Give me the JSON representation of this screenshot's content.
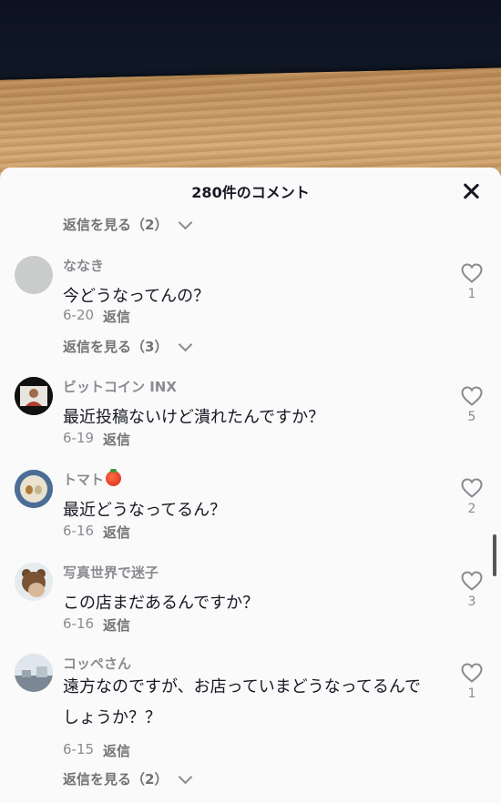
{
  "header": {
    "title": "280件のコメント"
  },
  "colors": {
    "sheet_bg": "#fafafa",
    "text": "#161823",
    "muted": "#8a8b91"
  },
  "view_replies_top": "返信を見る（2）",
  "comments": [
    {
      "username": "ななき",
      "text": "今どうなってんの？",
      "date": "6-20",
      "reply": "返信",
      "likes": "1",
      "view_replies": "返信を見る（3）",
      "avatar_icon": "gray-avatar"
    },
    {
      "username": "ビットコイン  INX",
      "text": "最近投稿ないけど潰れたんですか？",
      "date": "6-19",
      "reply": "返信",
      "likes": "5",
      "avatar_icon": "person-avatar"
    },
    {
      "username": "トマト",
      "text": "最近どうなってるん？",
      "date": "6-16",
      "reply": "返信",
      "likes": "2",
      "avatar_icon": "plate-avatar",
      "emoji": "tomato-icon"
    },
    {
      "username": "写真世界で迷子",
      "text": "この店まだあるんですか？",
      "date": "6-16",
      "reply": "返信",
      "likes": "3",
      "avatar_icon": "bear-avatar"
    },
    {
      "username": "コッペさん",
      "text": "遠方なのですが、お店っていまどうなってるんでしょうか？？",
      "date": "6-15",
      "reply": "返信",
      "likes": "1",
      "view_replies": "返信を見る（2）",
      "avatar_icon": "landscape-avatar"
    }
  ]
}
